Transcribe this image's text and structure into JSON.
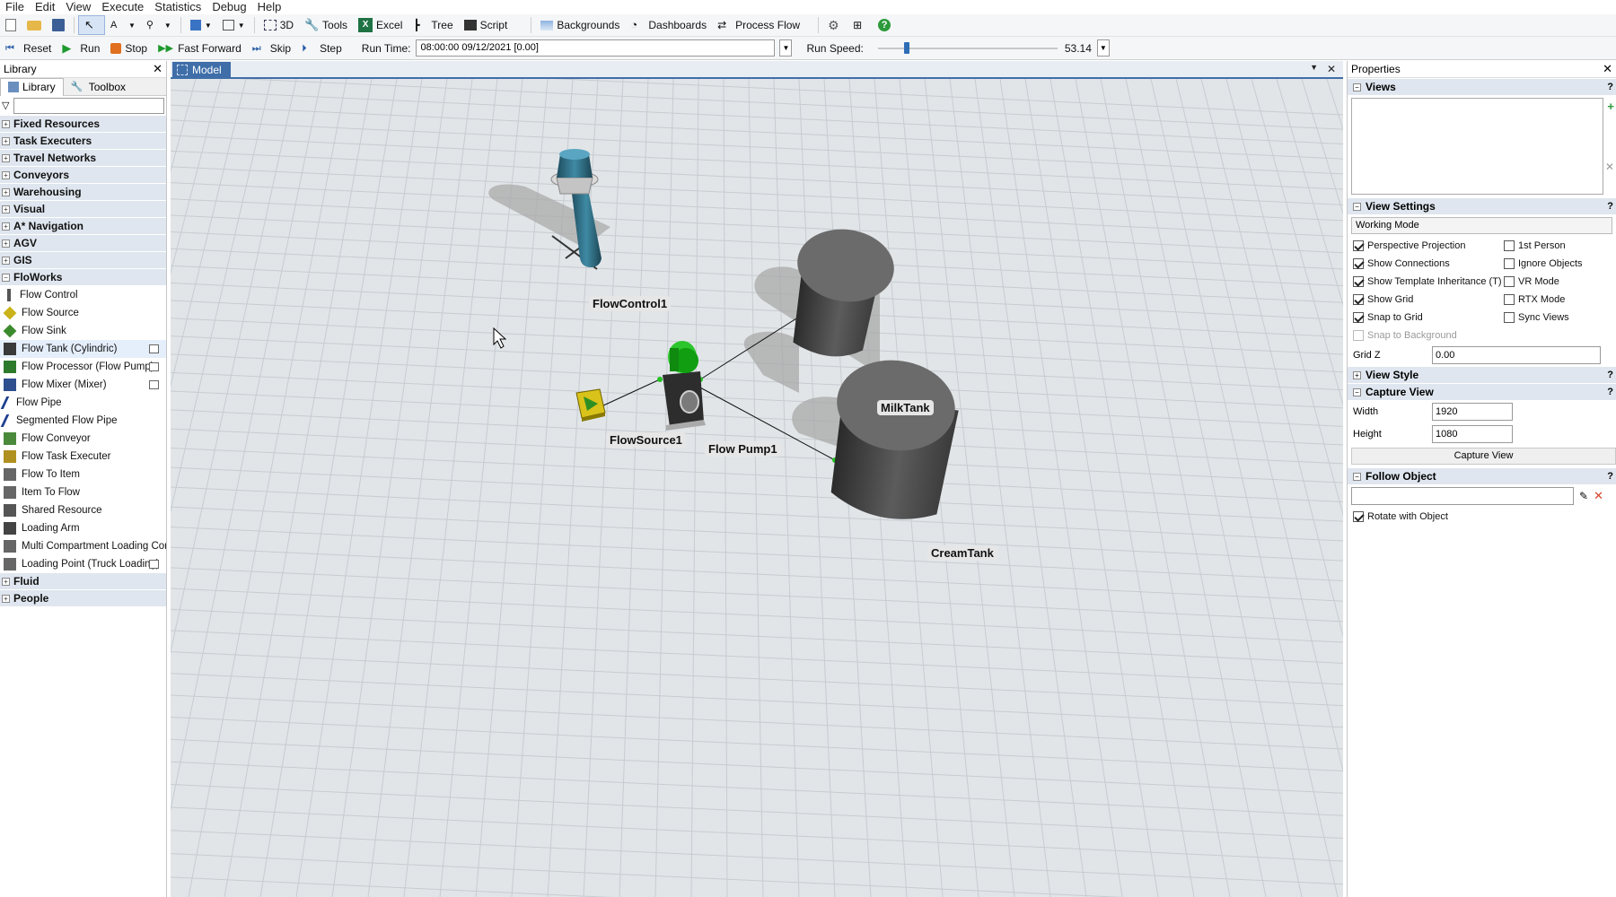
{
  "menu": [
    "File",
    "Edit",
    "View",
    "Execute",
    "Statistics",
    "Debug",
    "Help"
  ],
  "toolbar1": {
    "b3d": "3D",
    "tools": "Tools",
    "excel": "Excel",
    "tree": "Tree",
    "script": "Script",
    "backgrounds": "Backgrounds",
    "dashboards": "Dashboards",
    "processflow": "Process Flow"
  },
  "toolbar2": {
    "reset": "Reset",
    "run": "Run",
    "stop": "Stop",
    "fastforward": "Fast Forward",
    "skip": "Skip",
    "step": "Step",
    "runtime_label": "Run Time:",
    "runtime_value": "08:00:00  09/12/2021  [0.00]",
    "runspeed_label": "Run Speed:",
    "runspeed_value": "53.14",
    "runspeed_level": 0.15
  },
  "library": {
    "title": "Library",
    "tabs": [
      "Library",
      "Toolbox"
    ],
    "categories_before": [
      "Fixed Resources",
      "Task Executers",
      "Travel Networks",
      "Conveyors",
      "Warehousing",
      "Visual",
      "A* Navigation",
      "AGV",
      "GIS"
    ],
    "open_category": "FloWorks",
    "items": [
      {
        "label": "Flow Control",
        "icon": "flow-control-icon",
        "box": false
      },
      {
        "label": "Flow Source",
        "icon": "flow-source-icon",
        "box": false
      },
      {
        "label": "Flow Sink",
        "icon": "flow-sink-icon",
        "box": false
      },
      {
        "label": "Flow Tank (Cylindric)",
        "icon": "flow-tank-icon",
        "box": true,
        "selected": true
      },
      {
        "label": "Flow Processor (Flow Pump)",
        "icon": "flow-processor-icon",
        "box": true
      },
      {
        "label": "Flow Mixer (Mixer)",
        "icon": "flow-mixer-icon",
        "box": true
      },
      {
        "label": "Flow Pipe",
        "icon": "flow-pipe-icon",
        "box": false
      },
      {
        "label": "Segmented Flow Pipe",
        "icon": "segmented-pipe-icon",
        "box": false
      },
      {
        "label": "Flow Conveyor",
        "icon": "flow-conveyor-icon",
        "box": false
      },
      {
        "label": "Flow Task Executer",
        "icon": "flow-task-executer-icon",
        "box": false
      },
      {
        "label": "Flow To Item",
        "icon": "flow-to-item-icon",
        "box": false
      },
      {
        "label": "Item To Flow",
        "icon": "item-to-flow-icon",
        "box": false
      },
      {
        "label": "Shared Resource",
        "icon": "shared-resource-icon",
        "box": false
      },
      {
        "label": "Loading Arm",
        "icon": "loading-arm-icon",
        "box": false
      },
      {
        "label": "Multi Compartment Loading Contro",
        "icon": "multi-compartment-icon",
        "box": false
      },
      {
        "label": "Loading Point (Truck Loading)",
        "icon": "loading-point-icon",
        "box": true
      }
    ],
    "categories_after": [
      "Fluid",
      "People"
    ]
  },
  "model": {
    "tab": "Model",
    "objects": {
      "flowcontrol": "FlowControl1",
      "flowsource": "FlowSource1",
      "flowpump": "Flow Pump1",
      "milktank": "MilkTank",
      "creamtank": "CreamTank"
    }
  },
  "properties": {
    "title": "Properties",
    "views": "Views",
    "view_settings": "View Settings",
    "mode": "Working Mode",
    "checks_left": [
      {
        "label": "Perspective Projection",
        "on": true
      },
      {
        "label": "Show Connections",
        "on": true
      },
      {
        "label": "Show Template Inheritance (T)",
        "on": true
      },
      {
        "label": "Show Grid",
        "on": true
      },
      {
        "label": "Snap to Grid",
        "on": true
      },
      {
        "label": "Snap to Background",
        "on": false,
        "disabled": true
      }
    ],
    "checks_right": [
      {
        "label": "1st Person",
        "on": false
      },
      {
        "label": "Ignore Objects",
        "on": false
      },
      {
        "label": "VR Mode",
        "on": false
      },
      {
        "label": "RTX Mode",
        "on": false
      },
      {
        "label": "Sync Views",
        "on": false
      }
    ],
    "gridz_label": "Grid Z",
    "gridz_value": "0.00",
    "view_style": "View Style",
    "capture_view": "Capture View",
    "width_label": "Width",
    "width_value": "1920",
    "height_label": "Height",
    "height_value": "1080",
    "capture_button": "Capture View",
    "follow_object": "Follow Object",
    "rotate_label": "Rotate with Object",
    "rotate_on": true
  }
}
